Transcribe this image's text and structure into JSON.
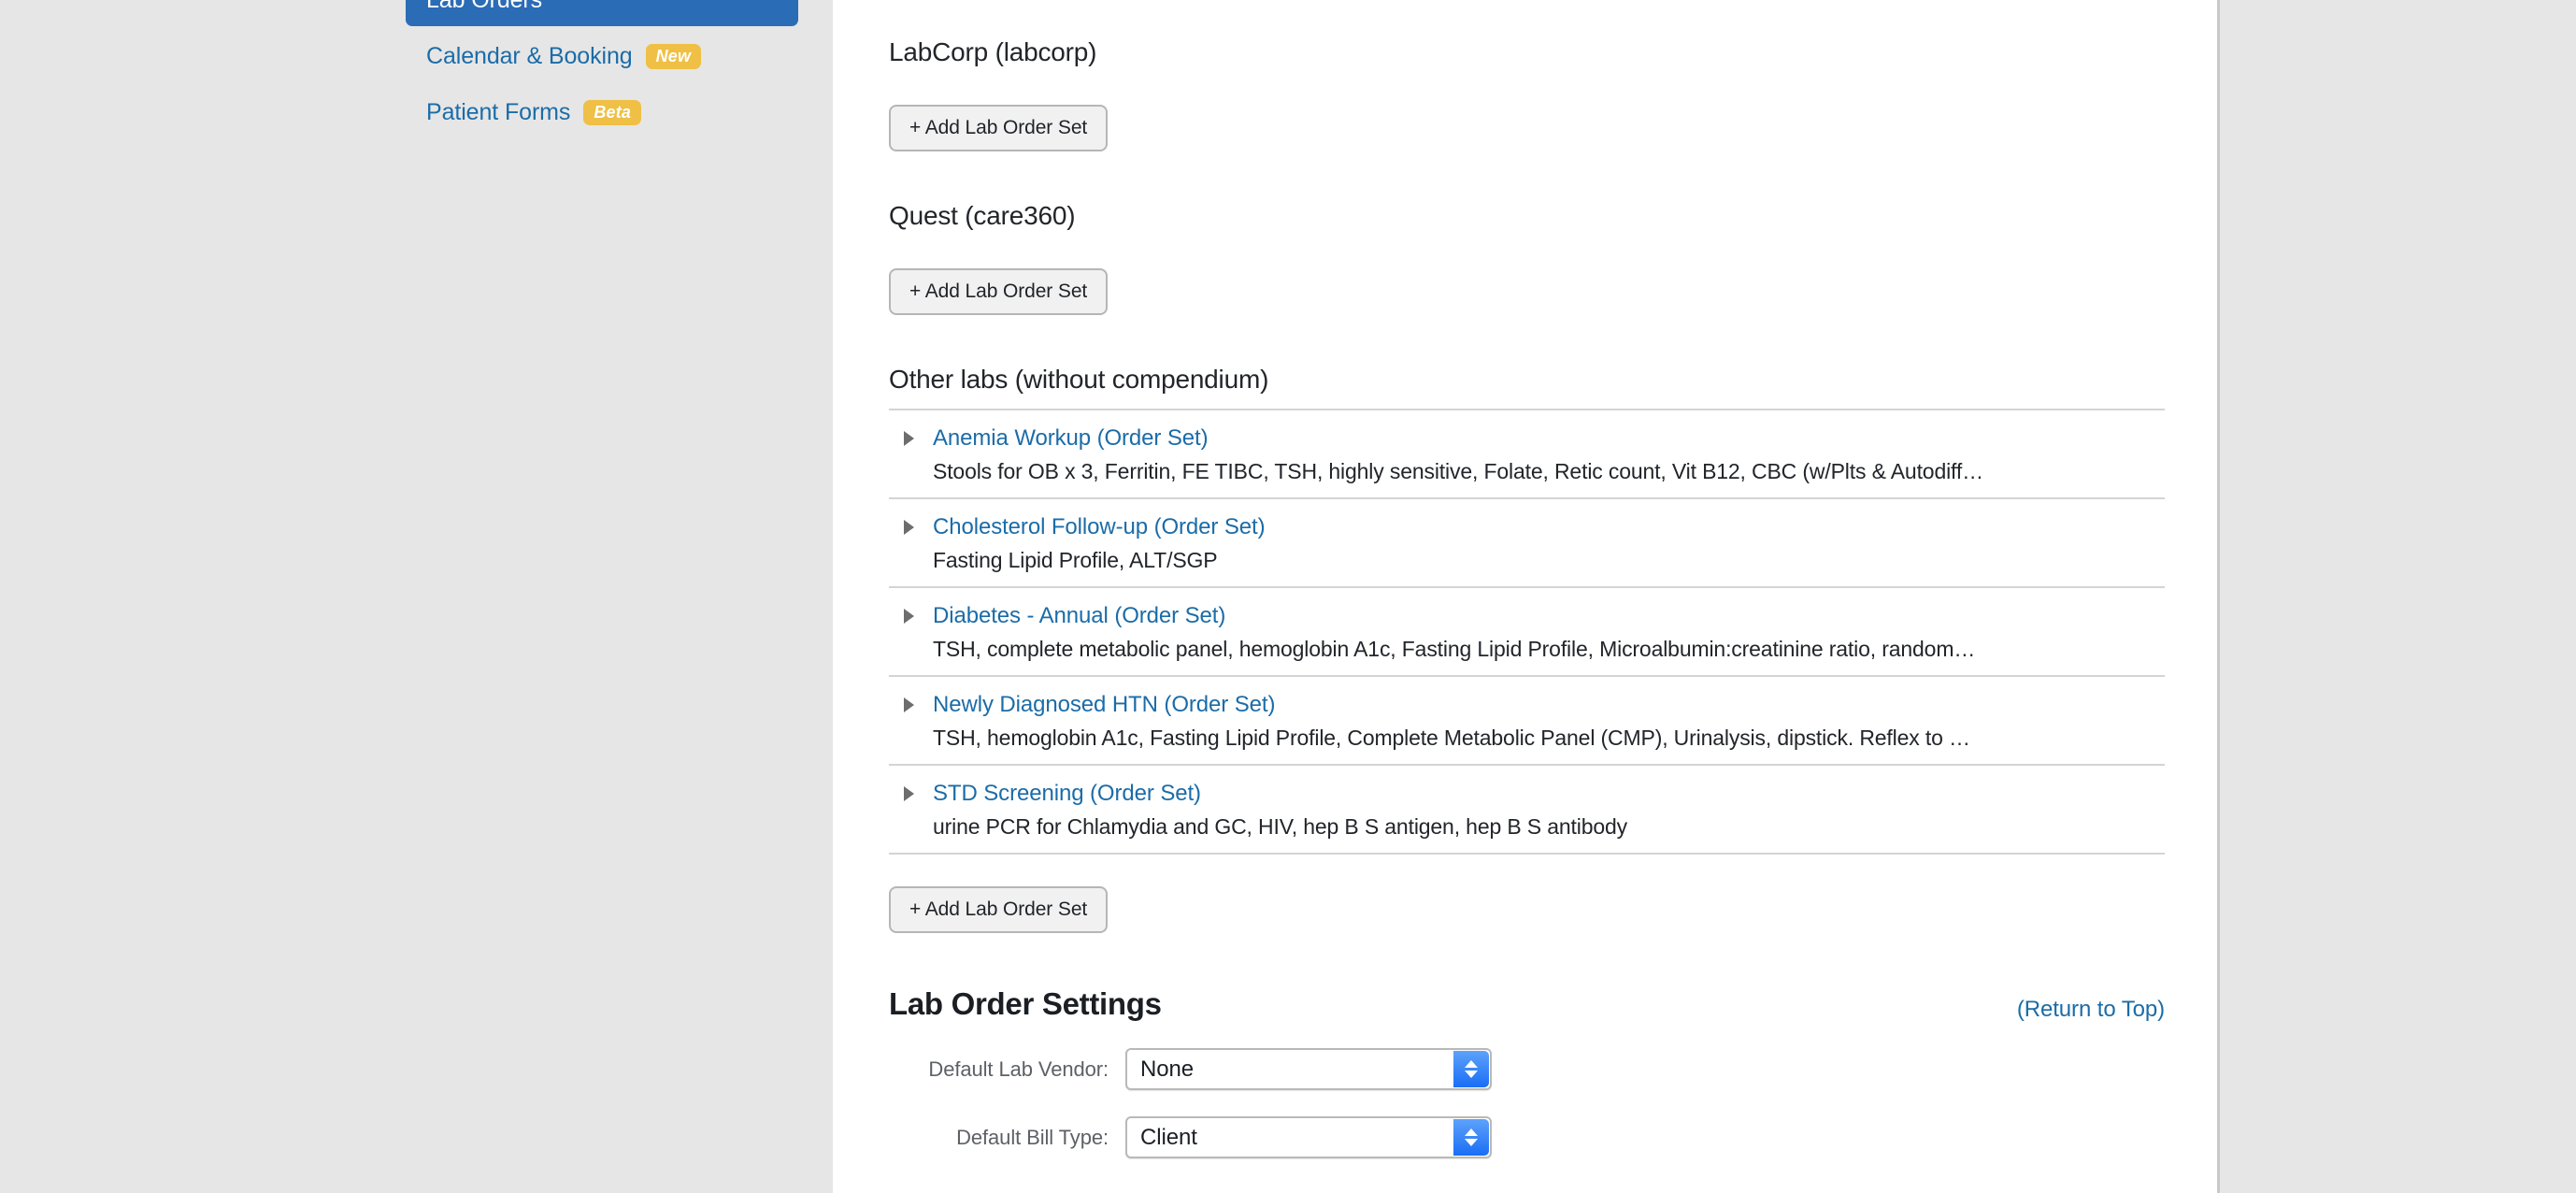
{
  "sidebar": {
    "items": [
      {
        "label": "Lab Orders",
        "badge": null,
        "active": true
      },
      {
        "label": "Calendar & Booking",
        "badge": "New",
        "active": false
      },
      {
        "label": "Patient Forms",
        "badge": "Beta",
        "active": false
      }
    ]
  },
  "main": {
    "vendors": [
      {
        "heading": "LabCorp (labcorp)",
        "add_button": "+ Add Lab Order Set"
      },
      {
        "heading": "Quest (care360)",
        "add_button": "+ Add Lab Order Set"
      }
    ],
    "other_labs": {
      "heading": "Other labs (without compendium)",
      "add_button": "+ Add Lab Order Set",
      "order_sets": [
        {
          "title": "Anemia Workup (Order Set)",
          "description": "Stools for OB x 3, Ferritin, FE TIBC, TSH, highly sensitive, Folate, Retic count, Vit B12, CBC (w/Plts & Autodiff…"
        },
        {
          "title": "Cholesterol Follow-up (Order Set)",
          "description": "Fasting Lipid Profile, ALT/SGP"
        },
        {
          "title": "Diabetes - Annual (Order Set)",
          "description": "TSH, complete metabolic panel, hemoglobin A1c, Fasting Lipid Profile, Microalbumin:creatinine ratio, random…"
        },
        {
          "title": "Newly Diagnosed HTN (Order Set)",
          "description": "TSH, hemoglobin A1c, Fasting Lipid Profile, Complete Metabolic Panel (CMP), Urinalysis, dipstick. Reflex to …"
        },
        {
          "title": "STD Screening (Order Set)",
          "description": "urine PCR for Chlamydia and GC, HIV, hep B S antigen, hep B S antibody"
        }
      ]
    },
    "settings": {
      "title": "Lab Order Settings",
      "return_to_top": "(Return to Top)",
      "fields": [
        {
          "label": "Default Lab Vendor:",
          "value": "None"
        },
        {
          "label": "Default Bill Type:",
          "value": "Client"
        }
      ]
    }
  },
  "colors": {
    "accent_blue": "#1b6ca8",
    "active_nav": "#2b6cb6",
    "badge_amber": "#efc045",
    "page_bg": "#e6e6e6"
  }
}
